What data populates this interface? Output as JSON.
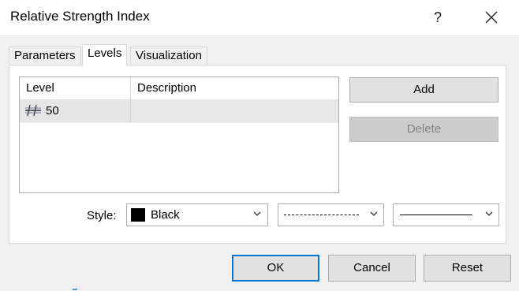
{
  "window": {
    "title": "Relative Strength Index",
    "help_label": "?"
  },
  "tabs": [
    {
      "label": "Parameters",
      "active": false
    },
    {
      "label": "Levels",
      "active": true
    },
    {
      "label": "Visualization",
      "active": false
    }
  ],
  "levels_table": {
    "columns": [
      "Level",
      "Description"
    ],
    "rows": [
      {
        "level": "50",
        "description": ""
      }
    ]
  },
  "buttons": {
    "add": "Add",
    "delete": "Delete",
    "ok": "OK",
    "cancel": "Cancel",
    "reset": "Reset"
  },
  "style": {
    "label": "Style:",
    "color_name": "Black",
    "color_hex": "#000000",
    "line_type": "dashed",
    "line_width": "thin"
  }
}
